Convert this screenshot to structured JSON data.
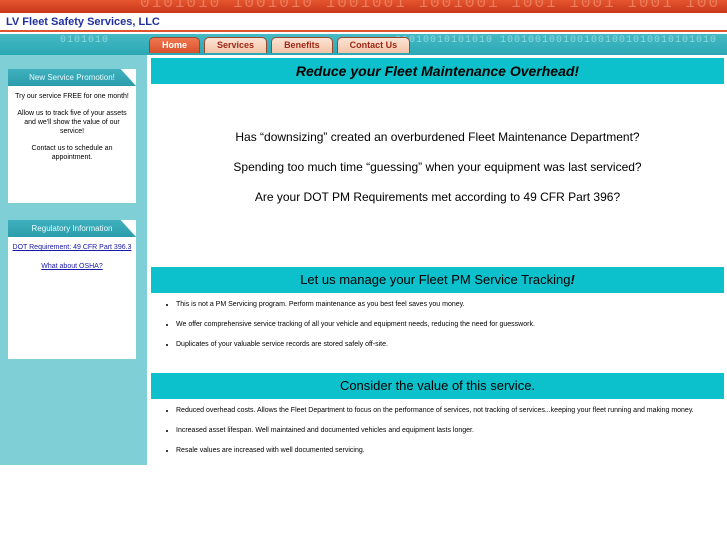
{
  "header": {
    "site_title": "LV Fleet Safety Services, LLC",
    "banner_binary": "0101010 1001010 1001001 1001001 1001 1001 1001 100",
    "nav_binary_left": "0101010",
    "nav_binary_right": "01010010101010 1001001001001001001010010101010"
  },
  "nav": {
    "tabs": [
      {
        "label": "Home"
      },
      {
        "label": "Services"
      },
      {
        "label": "Benefits"
      },
      {
        "label": "Contact Us"
      }
    ]
  },
  "sidebar": {
    "promo": {
      "title": "New Service Promotion!",
      "p1": "Try our service FREE for one month!",
      "p2": "Allow us to track five of your assets and we'll show the value of our service!",
      "p3": "Contact us to schedule an appointment."
    },
    "regulatory": {
      "title": "Regulatory Information",
      "link1": "DOT Requirement: 49 CFR Part 396.3",
      "link2": "What about OSHA?"
    }
  },
  "main": {
    "headline": "Reduce your Fleet Maintenance Overhead!",
    "questions": [
      "Has “downsizing” created an overburdened Fleet Maintenance Department?",
      "Spending too much time “guessing” when your equipment was last serviced?",
      "Are your DOT PM Requirements met according to 49 CFR Part 396?"
    ],
    "section1_title": "Let us manage your Fleet PM Service Tracking",
    "section1_title_end": "!",
    "section1_items": [
      "This is not a PM Servicing program.  Perform maintenance as you best feel saves you money.",
      "We offer comprehensive service tracking of all your vehicle and equipment needs, reducing the need for guesswork.",
      "Duplicates of your valuable service records are stored safely off-site."
    ],
    "section2_title": "Consider the value of this service.",
    "section2_items": [
      "Reduced overhead costs.  Allows the Fleet Department to focus on the performance of services, not tracking of services...keeping your fleet running and making money.",
      "Increased asset lifespan.  Well maintained and documented vehicles and equipment lasts longer.",
      "Resale values are increased with well documented servicing."
    ]
  },
  "colors": {
    "banner_red": "#c9361a",
    "teal": "#2aa8b4",
    "heading_teal": "#0cc1cb",
    "title_blue": "#2030a0"
  }
}
